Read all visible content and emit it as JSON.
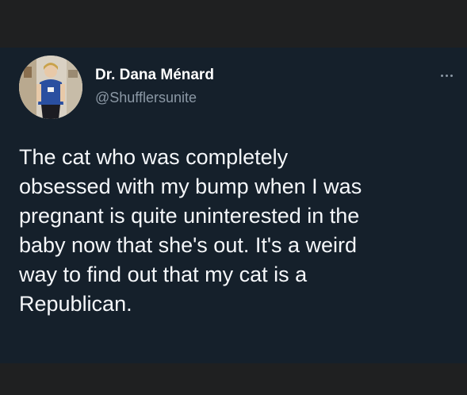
{
  "author": {
    "name": "Dr. Dana Ménard",
    "handle": "@Shufflersunite",
    "avatar_icon": "profile-photo"
  },
  "tweet": {
    "text": "The cat who was completely\nobsessed with my bump when I was\npregnant is quite uninterested in the\nbaby now that she's out. It's a weird\nway to find out that my cat is a\nRepublican."
  },
  "menu": {
    "icon": "more-options-icon"
  },
  "colors": {
    "card_background": "#15202b",
    "outer_background": "#1f2021",
    "primary_text": "#ffffff",
    "secondary_text": "#8b98a5"
  }
}
